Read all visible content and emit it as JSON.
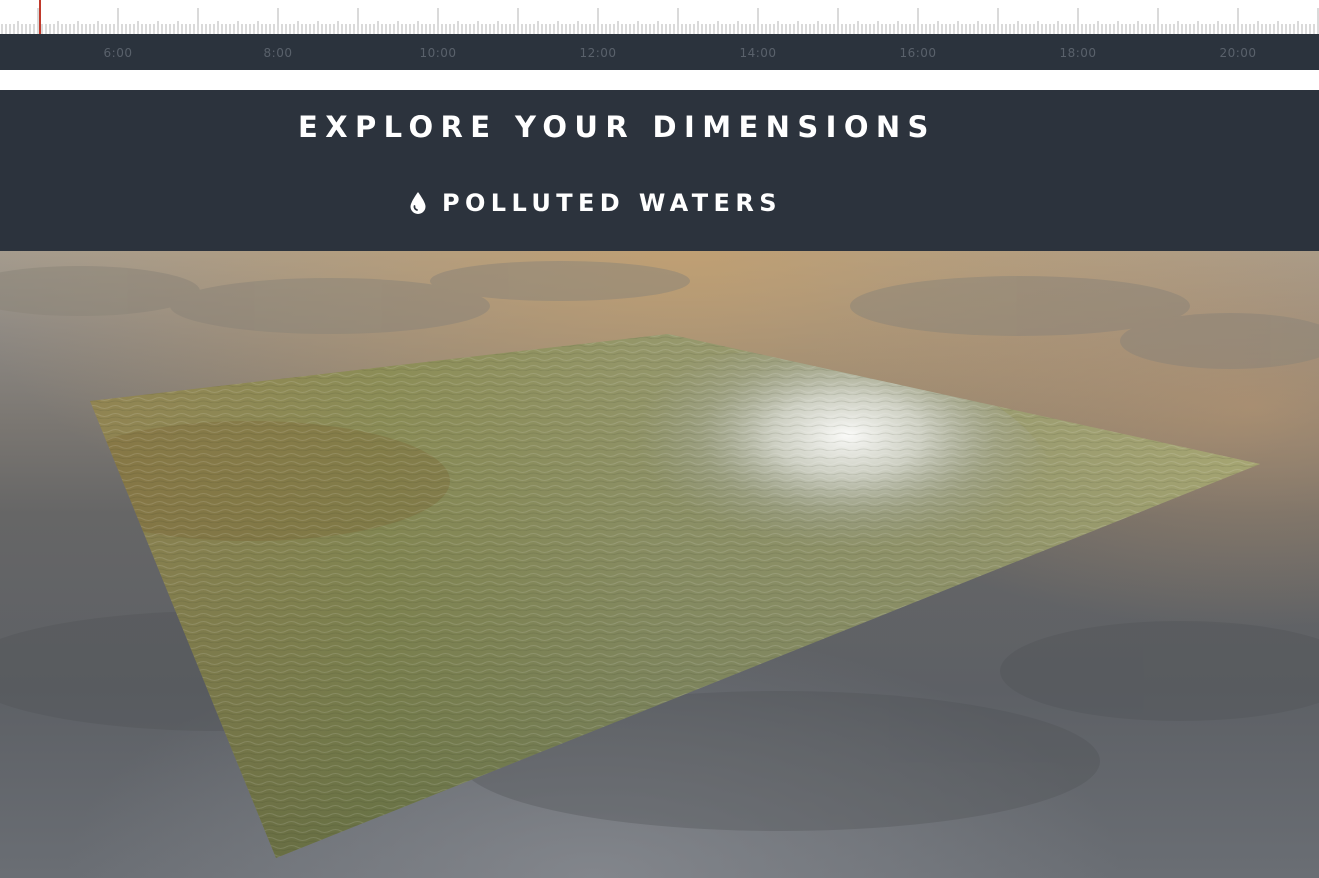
{
  "timeline": {
    "labels": [
      "6:00",
      "8:00",
      "10:00",
      "12:00",
      "14:00",
      "16:00",
      "18:00",
      "20:00"
    ],
    "cursor_color": "#c0392b"
  },
  "header": {
    "title": "EXPLORE YOUR DIMENSIONS",
    "subtitle": "POLLUTED WATERS",
    "subtitle_icon": "water-drop-icon"
  },
  "colors": {
    "header_bg": "#2c333d",
    "timebar_bg": "#2b333d",
    "label_text": "#ffffff"
  }
}
